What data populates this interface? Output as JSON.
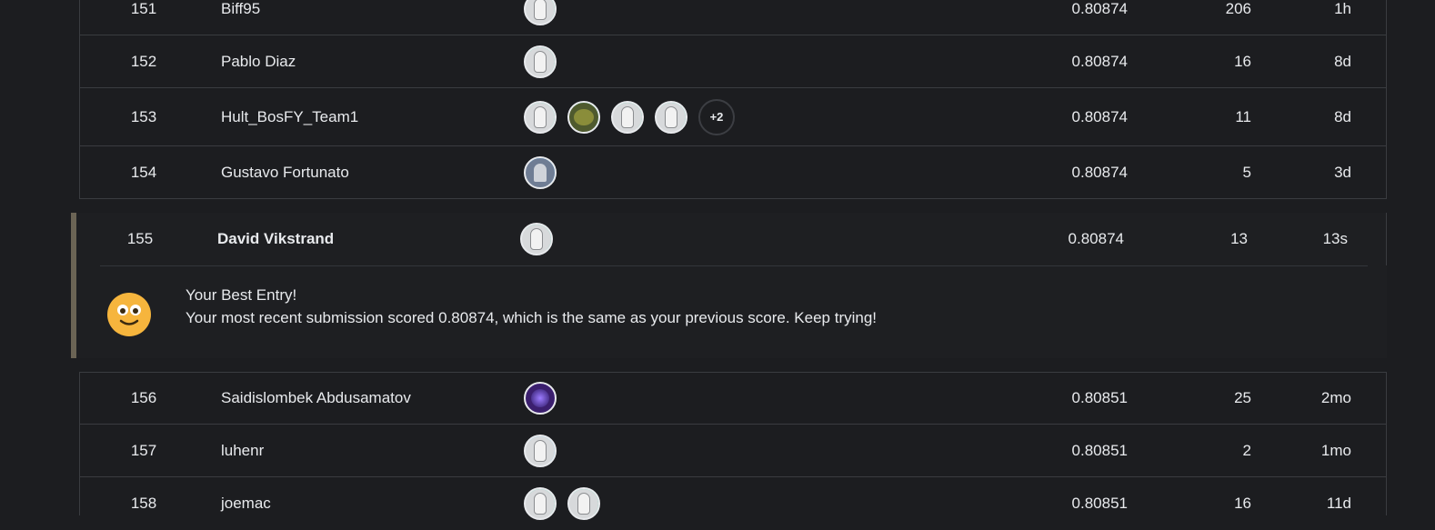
{
  "rows_top": [
    {
      "rank": "151",
      "team": "Biff95",
      "score": "0.80874",
      "entries": "206",
      "last": "1h",
      "avatars": [
        {
          "type": "goose",
          "ring": "green"
        }
      ]
    },
    {
      "rank": "152",
      "team": "Pablo Diaz",
      "score": "0.80874",
      "entries": "16",
      "last": "8d",
      "avatars": [
        {
          "type": "goose",
          "ring": "green"
        }
      ]
    },
    {
      "rank": "153",
      "team": "Hult_BosFY_Team1",
      "score": "0.80874",
      "entries": "11",
      "last": "8d",
      "avatars": [
        {
          "type": "goose",
          "ring": "green"
        },
        {
          "type": "photo-frog",
          "ring": "green"
        },
        {
          "type": "goose",
          "ring": "green"
        },
        {
          "type": "goose",
          "ring": "green"
        }
      ],
      "more": "+2"
    },
    {
      "rank": "154",
      "team": "Gustavo Fortunato",
      "score": "0.80874",
      "entries": "5",
      "last": "3d",
      "avatars": [
        {
          "type": "photo-person",
          "ring": "blue"
        }
      ]
    }
  ],
  "my_entry": {
    "rank": "155",
    "team": "David Vikstrand",
    "score": "0.80874",
    "entries": "13",
    "last": "13s",
    "avatars": [
      {
        "type": "goose",
        "ring": "green"
      }
    ],
    "message_title": "Your Best Entry!",
    "message_body": "Your most recent submission scored 0.80874, which is the same as your previous score. Keep trying!",
    "icon": "smiley-icon"
  },
  "rows_bottom": [
    {
      "rank": "156",
      "team": "Saidislombek Abdusamatov",
      "score": "0.80851",
      "entries": "25",
      "last": "2mo",
      "avatars": [
        {
          "type": "photo-galaxy",
          "ring": "purple"
        }
      ]
    },
    {
      "rank": "157",
      "team": "luhenr",
      "score": "0.80851",
      "entries": "2",
      "last": "1mo",
      "avatars": [
        {
          "type": "goose",
          "ring": "blue"
        }
      ]
    },
    {
      "rank": "158",
      "team": "joemac",
      "score": "0.80851",
      "entries": "16",
      "last": "11d",
      "avatars": [
        {
          "type": "goose",
          "ring": "green"
        },
        {
          "type": "goose",
          "ring": "green"
        }
      ]
    }
  ],
  "colors": {
    "background": "#1c1d20",
    "border": "#3a3c40",
    "accent_green": "#20c997",
    "accent_blue": "#2fb3ff",
    "smiley": "#f6b53d"
  }
}
